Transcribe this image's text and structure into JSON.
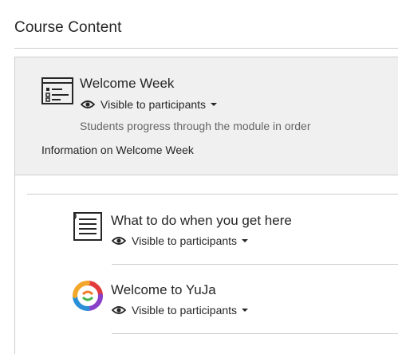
{
  "section": {
    "heading": "Course Content"
  },
  "module": {
    "title": "Welcome Week",
    "visibility": "Visible to participants",
    "description": "Students progress through the module in order",
    "info": "Information on Welcome Week",
    "icon": "learning-module-icon"
  },
  "items": [
    {
      "title": "What to do when you get here",
      "visibility": "Visible to participants",
      "icon": "document-icon"
    },
    {
      "title": "Welcome to YuJa",
      "visibility": "Visible to participants",
      "icon": "yuja-logo-icon"
    }
  ],
  "colors": {
    "header_bg": "#f0f0f0",
    "divider": "#cdcdcd",
    "text": "#262626",
    "muted": "#666666"
  }
}
